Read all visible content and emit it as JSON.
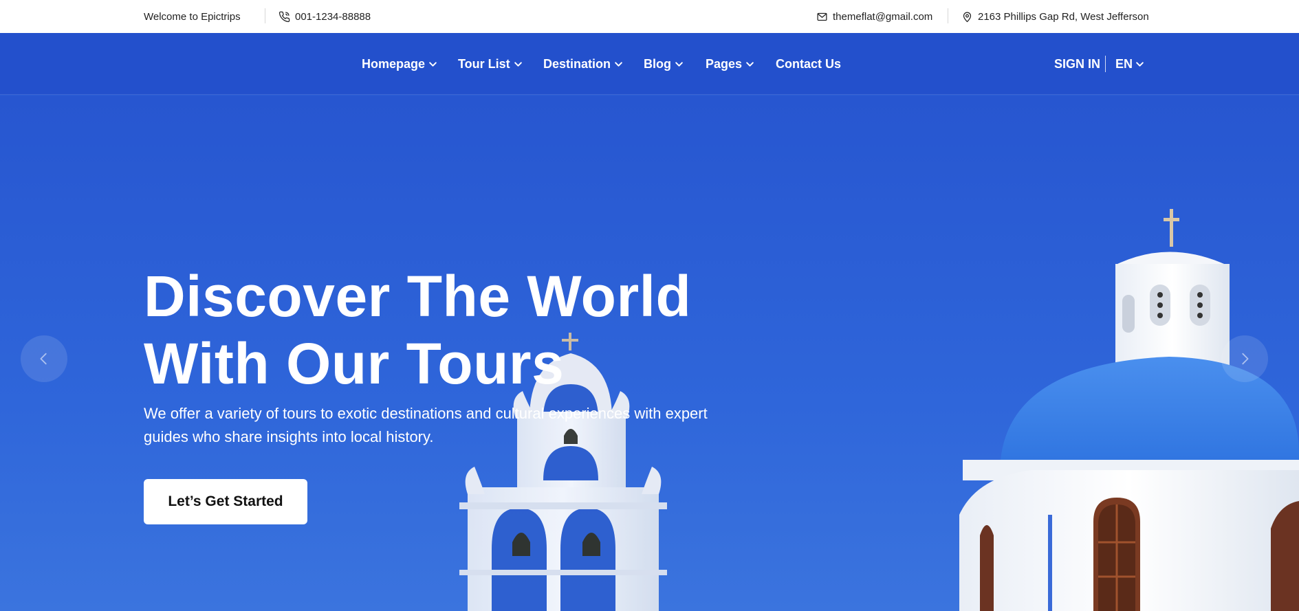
{
  "topbar": {
    "welcome": "Welcome to Epictrips",
    "phone": "001-1234-88888",
    "email": "themeflat@gmail.com",
    "address": "2163 Phillips Gap Rd, West Jefferson"
  },
  "nav": {
    "items": [
      {
        "label": "Homepage",
        "has_dropdown": true
      },
      {
        "label": "Tour List",
        "has_dropdown": true
      },
      {
        "label": "Destination",
        "has_dropdown": true
      },
      {
        "label": "Blog",
        "has_dropdown": true
      },
      {
        "label": "Pages",
        "has_dropdown": true
      },
      {
        "label": "Contact Us",
        "has_dropdown": false
      }
    ],
    "sign_in": "SIGN IN",
    "language": "EN"
  },
  "hero": {
    "title_line1": "Discover The World",
    "title_line2": "With Our Tours",
    "subtitle_line1": "We offer a variety of tours to exotic destinations and cultural experiences with expert",
    "subtitle_line2": "guides who share insights into local history.",
    "cta_label": "Let’s Get Started",
    "prev_icon": "chevron-left-icon",
    "next_icon": "chevron-right-icon"
  },
  "colors": {
    "nav_bg": "#2350cc",
    "hero_sky": "#2f65d9",
    "dome_blue": "#3f86e8",
    "text_light": "#ffffff"
  }
}
